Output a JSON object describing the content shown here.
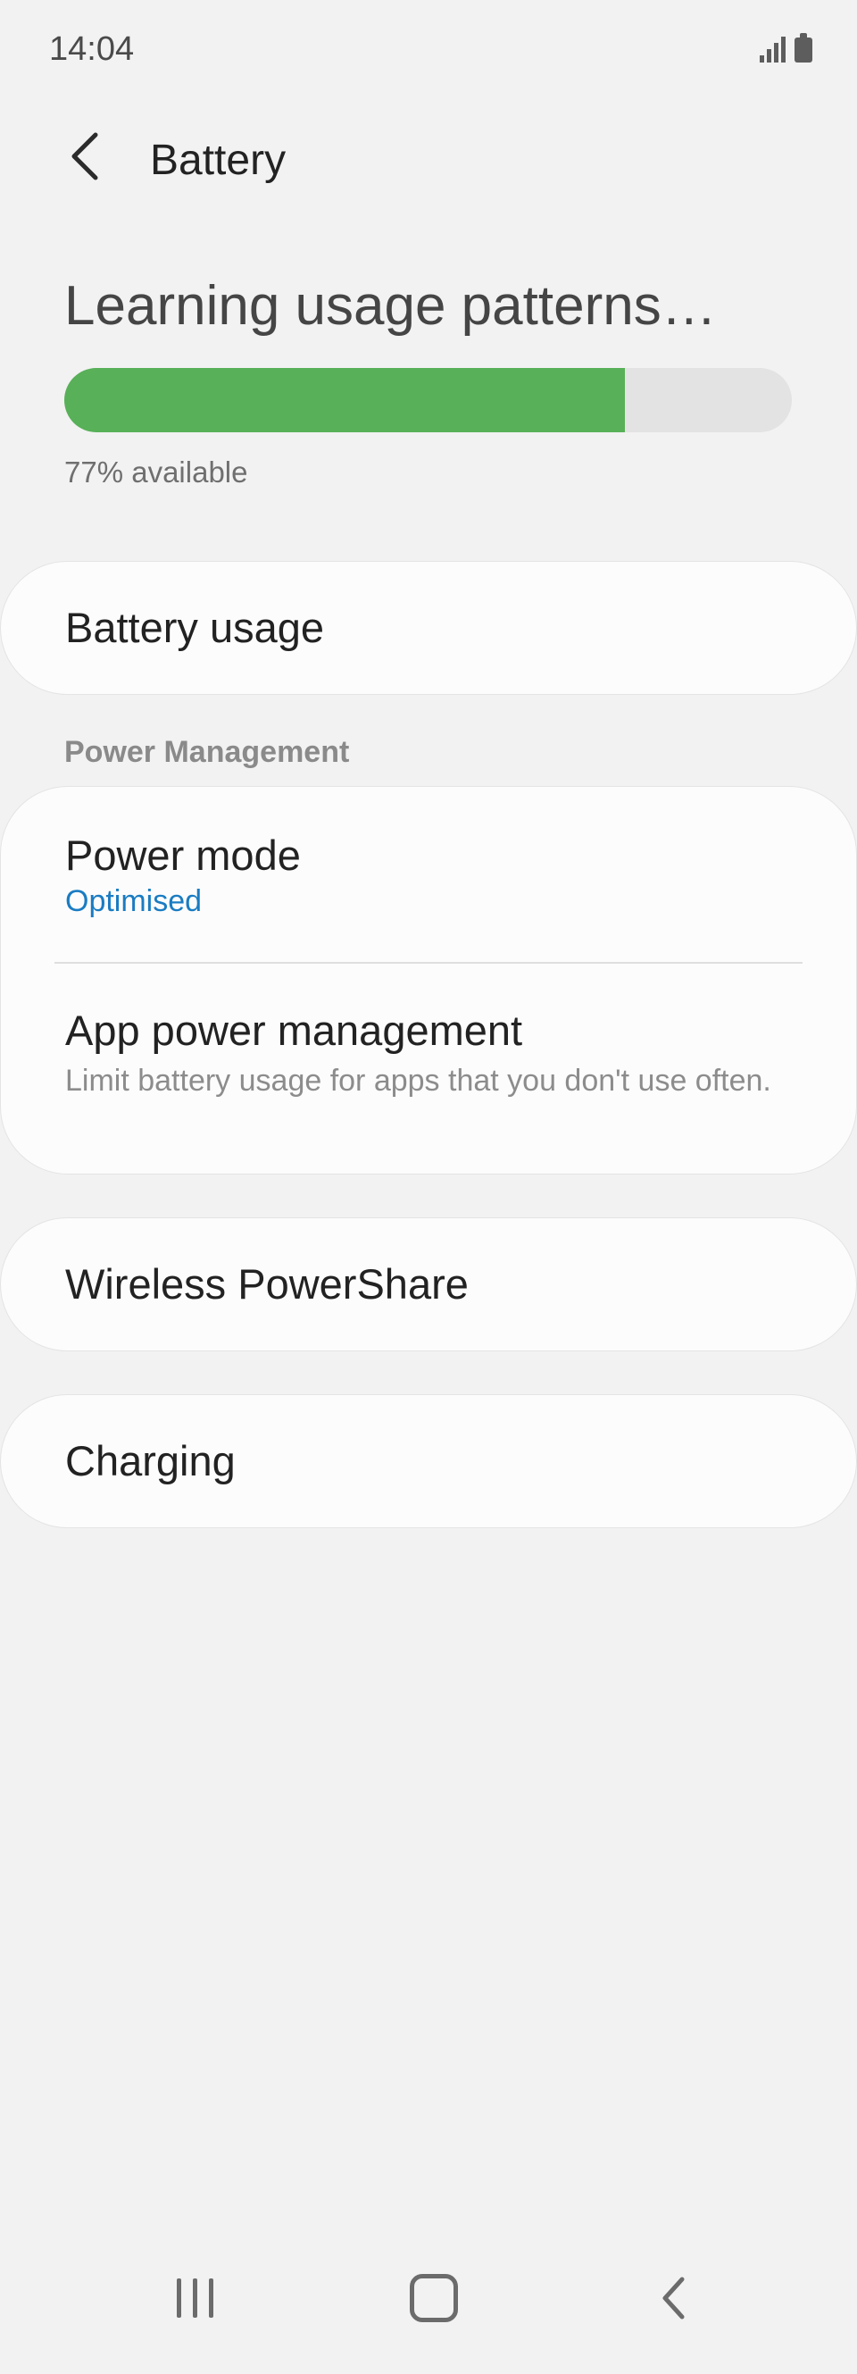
{
  "status_bar": {
    "time": "14:04",
    "signal_icon": "signal-icon",
    "battery_icon": "battery-icon"
  },
  "header": {
    "back_icon": "back-arrow-icon",
    "title": "Battery"
  },
  "battery_status": {
    "heading": "Learning usage patterns…",
    "level_percent": 77,
    "available_text": "77% available",
    "fill_color": "#58b058"
  },
  "battery_usage": {
    "label": "Battery usage"
  },
  "power_management": {
    "section_title": "Power Management",
    "power_mode": {
      "label": "Power mode",
      "value": "Optimised"
    },
    "app_power": {
      "label": "App power management",
      "description": "Limit battery usage for apps that you don't use often."
    }
  },
  "wireless_powershare": {
    "label": "Wireless PowerShare"
  },
  "charging": {
    "label": "Charging"
  },
  "nav_bar": {
    "recents_icon": "recents-icon",
    "home_icon": "home-icon",
    "back_icon": "back-icon"
  },
  "colors": {
    "accent": "#1a7cc2",
    "background": "#f2f2f2"
  }
}
